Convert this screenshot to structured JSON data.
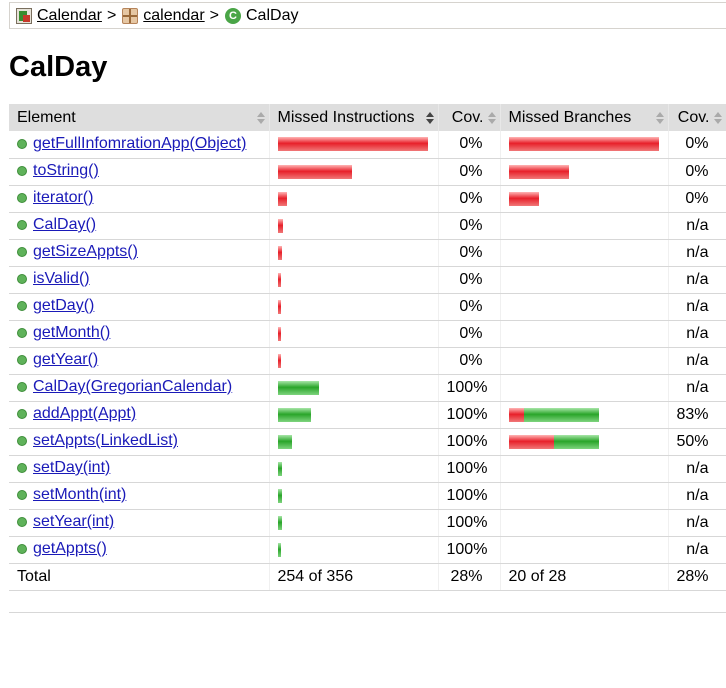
{
  "breadcrumb": {
    "items": [
      {
        "label": "Calendar",
        "icon": "report-icon"
      },
      {
        "label": "calendar",
        "icon": "package-icon"
      },
      {
        "label": "CalDay",
        "icon": "class-icon"
      }
    ],
    "separator": ">"
  },
  "page_title": "CalDay",
  "table": {
    "headers": {
      "element": "Element",
      "missed_instructions": "Missed Instructions",
      "cov_instructions": "Cov.",
      "missed_branches": "Missed Branches",
      "cov_branches": "Cov."
    },
    "rows": [
      {
        "name": "getFullInfomrationApp(Object)",
        "instr_missed": 1.0,
        "instr_covered": 0,
        "instr_cov": "0%",
        "br_missed": 1.0,
        "br_covered": 0,
        "br_cov": "0%"
      },
      {
        "name": "toString()",
        "instr_missed": 0.49,
        "instr_covered": 0,
        "instr_cov": "0%",
        "br_missed": 0.4,
        "br_covered": 0,
        "br_cov": "0%"
      },
      {
        "name": "iterator()",
        "instr_missed": 0.06,
        "instr_covered": 0,
        "instr_cov": "0%",
        "br_missed": 0.2,
        "br_covered": 0,
        "br_cov": "0%"
      },
      {
        "name": "CalDay()",
        "instr_missed": 0.035,
        "instr_covered": 0,
        "instr_cov": "0%",
        "br_missed": 0,
        "br_covered": 0,
        "br_cov": "n/a"
      },
      {
        "name": "getSizeAppts()",
        "instr_missed": 0.027,
        "instr_covered": 0,
        "instr_cov": "0%",
        "br_missed": 0,
        "br_covered": 0,
        "br_cov": "n/a"
      },
      {
        "name": "isValid()",
        "instr_missed": 0.02,
        "instr_covered": 0,
        "instr_cov": "0%",
        "br_missed": 0,
        "br_covered": 0,
        "br_cov": "n/a"
      },
      {
        "name": "getDay()",
        "instr_missed": 0.02,
        "instr_covered": 0,
        "instr_cov": "0%",
        "br_missed": 0,
        "br_covered": 0,
        "br_cov": "n/a"
      },
      {
        "name": "getMonth()",
        "instr_missed": 0.02,
        "instr_covered": 0,
        "instr_cov": "0%",
        "br_missed": 0,
        "br_covered": 0,
        "br_cov": "n/a"
      },
      {
        "name": "getYear()",
        "instr_missed": 0.02,
        "instr_covered": 0,
        "instr_cov": "0%",
        "br_missed": 0,
        "br_covered": 0,
        "br_cov": "n/a"
      },
      {
        "name": "CalDay(GregorianCalendar)",
        "instr_missed": 0,
        "instr_covered": 0.27,
        "instr_cov": "100%",
        "br_missed": 0,
        "br_covered": 0,
        "br_cov": "n/a"
      },
      {
        "name": "addAppt(Appt)",
        "instr_missed": 0,
        "instr_covered": 0.22,
        "instr_cov": "100%",
        "br_missed": 0.1,
        "br_covered": 0.5,
        "br_cov": "83%"
      },
      {
        "name": "setAppts(LinkedList)",
        "instr_missed": 0,
        "instr_covered": 0.09,
        "instr_cov": "100%",
        "br_missed": 0.3,
        "br_covered": 0.3,
        "br_cov": "50%"
      },
      {
        "name": "setDay(int)",
        "instr_missed": 0,
        "instr_covered": 0.027,
        "instr_cov": "100%",
        "br_missed": 0,
        "br_covered": 0,
        "br_cov": "n/a"
      },
      {
        "name": "setMonth(int)",
        "instr_missed": 0,
        "instr_covered": 0.027,
        "instr_cov": "100%",
        "br_missed": 0,
        "br_covered": 0,
        "br_cov": "n/a"
      },
      {
        "name": "setYear(int)",
        "instr_missed": 0,
        "instr_covered": 0.027,
        "instr_cov": "100%",
        "br_missed": 0,
        "br_covered": 0,
        "br_cov": "n/a"
      },
      {
        "name": "getAppts()",
        "instr_missed": 0,
        "instr_covered": 0.02,
        "instr_cov": "100%",
        "br_missed": 0,
        "br_covered": 0,
        "br_cov": "n/a"
      }
    ],
    "total": {
      "label": "Total",
      "instr": "254 of 356",
      "instr_cov": "28%",
      "br": "20 of 28",
      "br_cov": "28%"
    }
  },
  "colors": {
    "missed": "#e8202a",
    "covered": "#2aa52a",
    "header_bg": "#dedede",
    "link": "#1a1ab8"
  }
}
